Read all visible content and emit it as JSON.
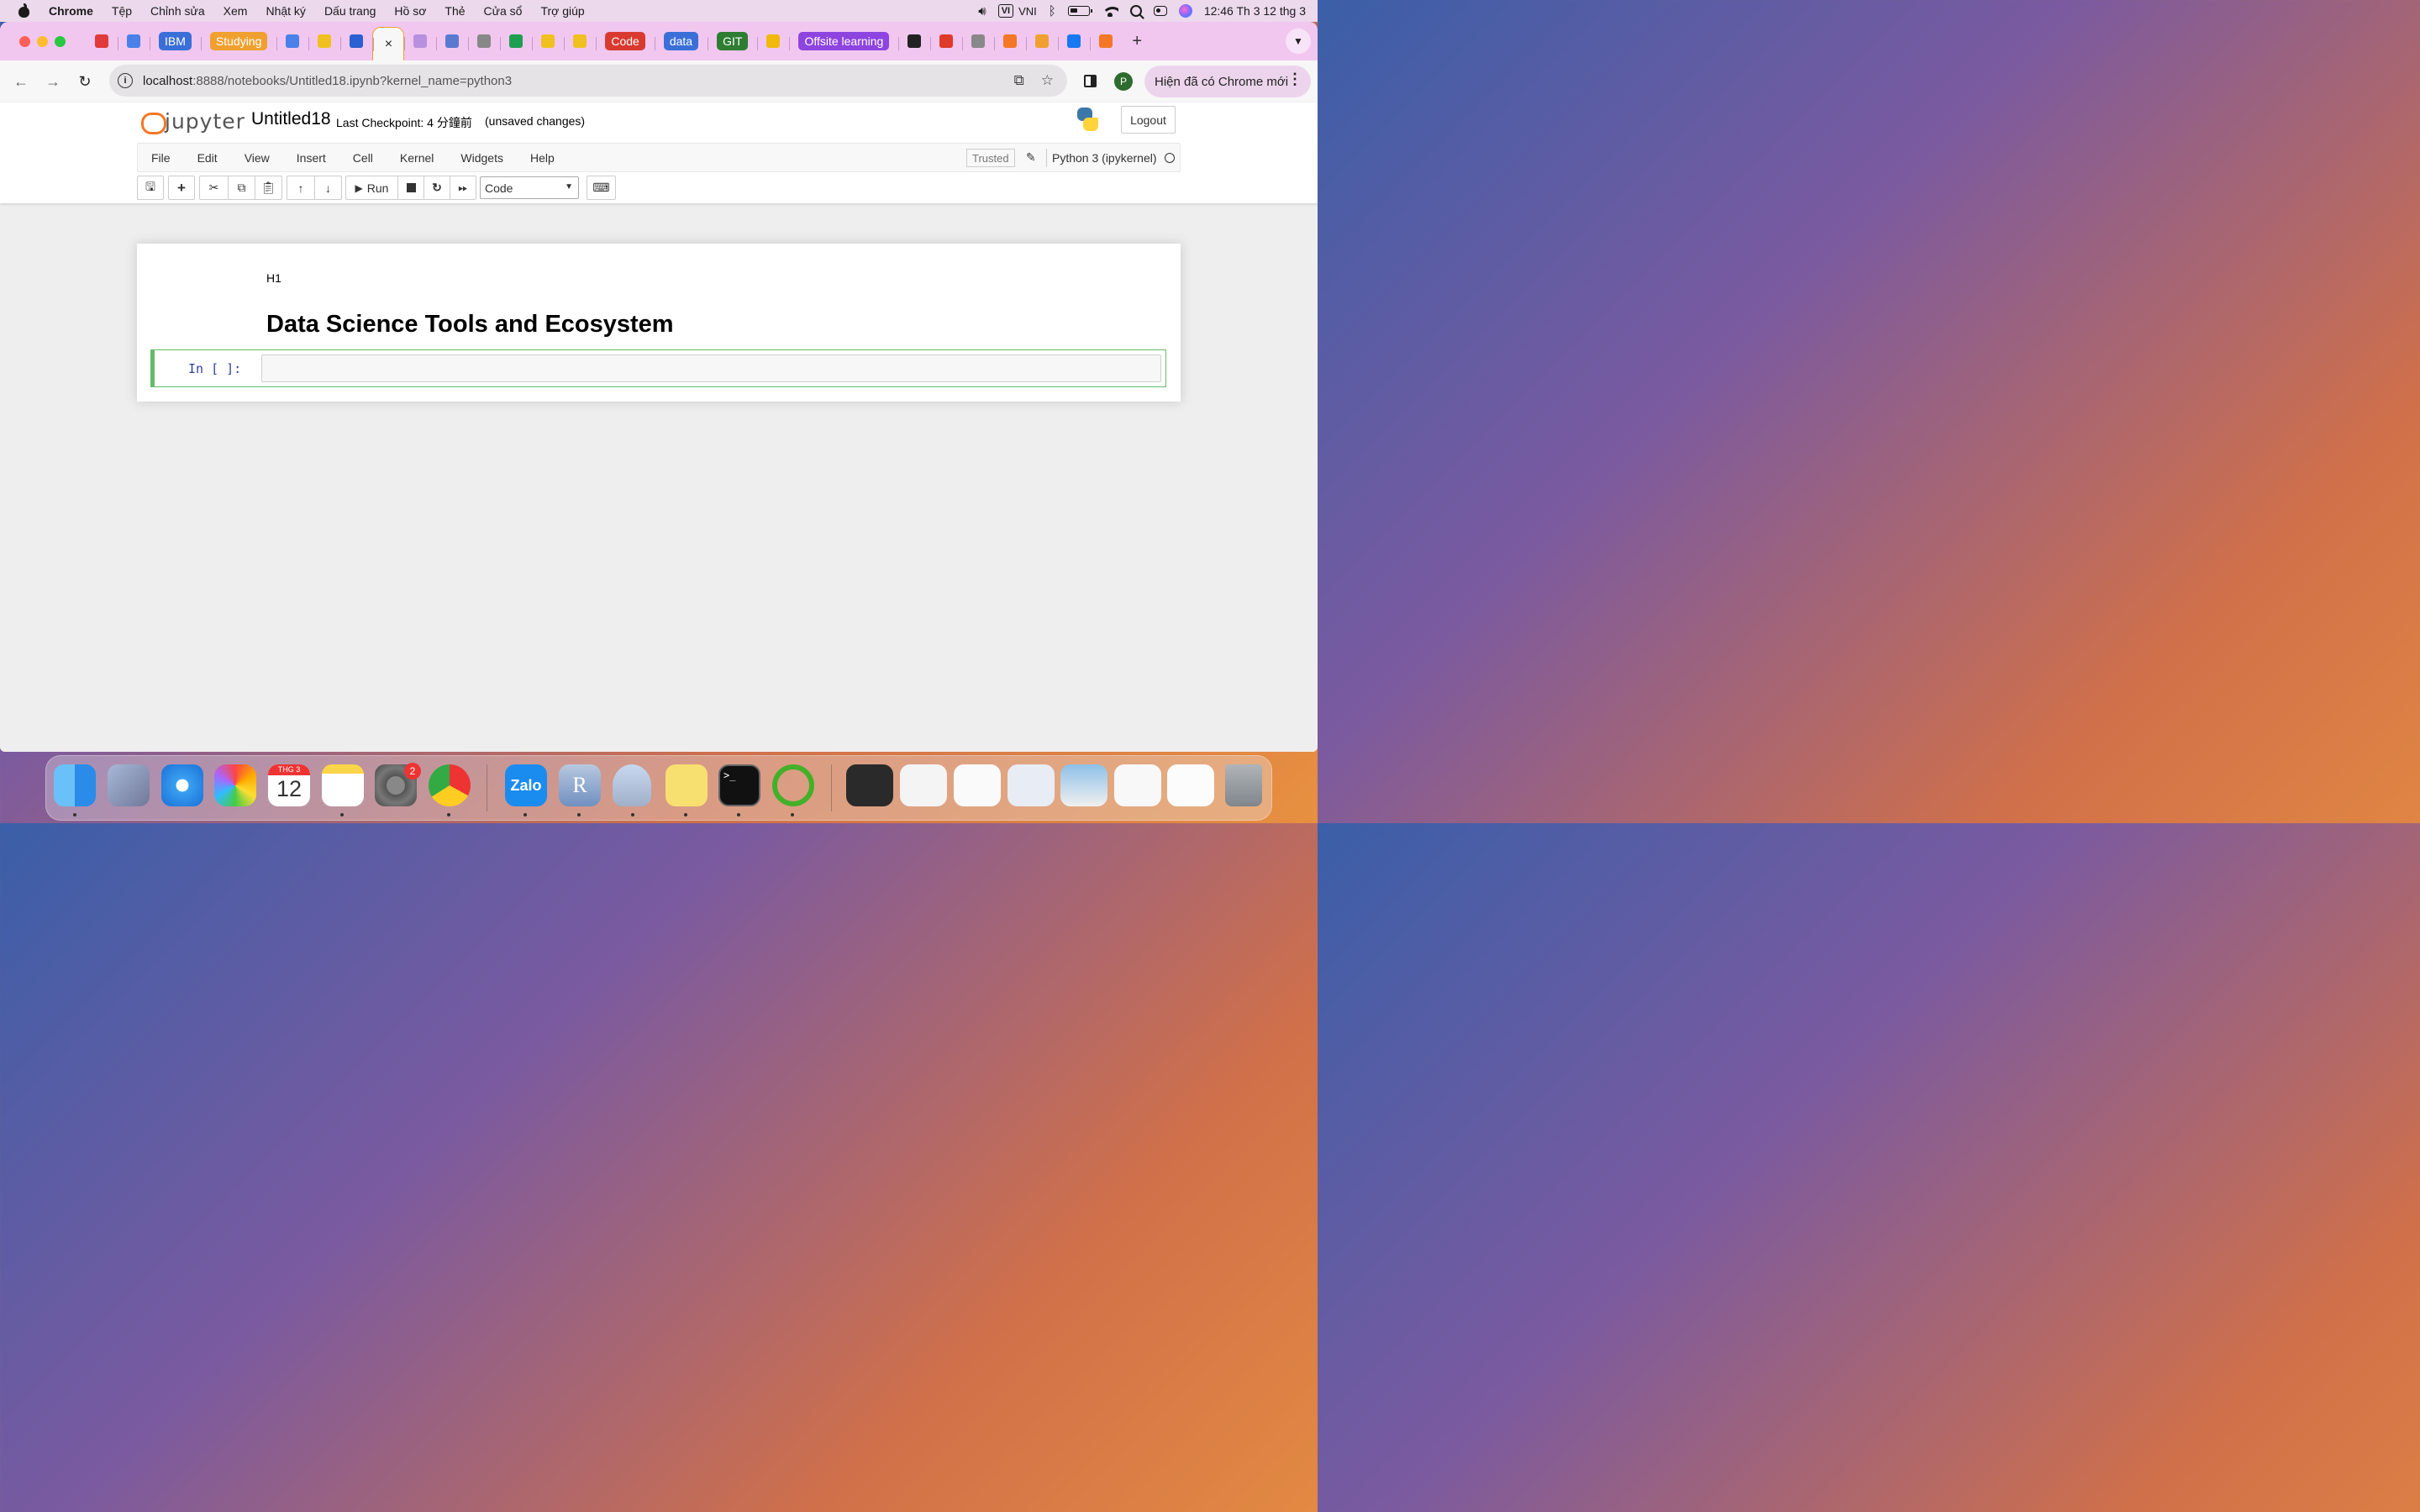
{
  "macos_menubar": {
    "app_name": "Chrome",
    "menus": [
      "Tệp",
      "Chỉnh sửa",
      "Xem",
      "Nhật ký",
      "Dấu trang",
      "Hồ sơ",
      "Thẻ",
      "Cửa sổ",
      "Trợ giúp"
    ],
    "input_method": "VI",
    "input_label": "VNI",
    "clock": "12:46 Th 3 12 thg 3"
  },
  "browser": {
    "tabs": [
      {
        "kind": "favicon",
        "icon": "red-square-icon",
        "color": "#e03a3a"
      },
      {
        "kind": "favicon",
        "icon": "google-docs-icon",
        "color": "#4a80e8"
      },
      {
        "kind": "pill",
        "label": "IBM",
        "color": "#3a6fd8"
      },
      {
        "kind": "pill",
        "label": "Studying",
        "color": "#f0a030"
      },
      {
        "kind": "favicon",
        "icon": "google-docs-icon",
        "color": "#4a80e8"
      },
      {
        "kind": "favicon",
        "icon": "lightbulb-icon",
        "color": "#f0c020"
      },
      {
        "kind": "favicon",
        "icon": "c-logo-icon",
        "color": "#2a60d0"
      },
      {
        "kind": "active",
        "label": "×"
      },
      {
        "kind": "favicon",
        "icon": "aperture-icon",
        "color": "#b890e0"
      },
      {
        "kind": "favicon",
        "icon": "translate-icon",
        "color": "#5a7ad0"
      },
      {
        "kind": "favicon",
        "icon": "globe-icon",
        "color": "#888888"
      },
      {
        "kind": "favicon",
        "icon": "google-sheets-icon",
        "color": "#1e9e50"
      },
      {
        "kind": "favicon",
        "icon": "lightbulb-icon",
        "color": "#f0c020"
      },
      {
        "kind": "favicon",
        "icon": "lightbulb-icon",
        "color": "#f0c020"
      },
      {
        "kind": "pill",
        "label": "Code",
        "color": "#d93a30"
      },
      {
        "kind": "pill",
        "label": "data",
        "color": "#3a6fd8"
      },
      {
        "kind": "pill",
        "label": "GIT",
        "color": "#2e7d32"
      },
      {
        "kind": "favicon",
        "icon": "binance-icon",
        "color": "#f0b90b"
      },
      {
        "kind": "pill",
        "label": "Offsite learning",
        "color": "#8e44e0"
      },
      {
        "kind": "favicon",
        "icon": "jpm-icon",
        "color": "#222222"
      },
      {
        "kind": "favicon",
        "icon": "t-logo-icon",
        "color": "#e03a2a"
      },
      {
        "kind": "favicon",
        "icon": "github-icon",
        "color": "#888888"
      },
      {
        "kind": "favicon",
        "icon": "jupyter-icon",
        "color": "#f37726"
      },
      {
        "kind": "favicon",
        "icon": "bars-icon",
        "color": "#f0a030"
      },
      {
        "kind": "favicon",
        "icon": "facebook-icon",
        "color": "#1877f2"
      },
      {
        "kind": "favicon",
        "icon": "jupyter-icon",
        "color": "#f37726"
      }
    ],
    "new_tab": "+",
    "url_host": "localhost",
    "url_path": ":8888/notebooks/Untitled18.ipynb?kernel_name=python3",
    "profile_initial": "P",
    "new_chrome_label": "Hiện đã có Chrome mới"
  },
  "jupyter": {
    "logo_text": "jupyter",
    "notebook_title": "Untitled18",
    "checkpoint": "Last Checkpoint: 4 分鐘前",
    "unsaved": "(unsaved changes)",
    "logout": "Logout",
    "menu": [
      "File",
      "Edit",
      "View",
      "Insert",
      "Cell",
      "Kernel",
      "Widgets",
      "Help"
    ],
    "trusted": "Trusted",
    "kernel": "Python 3 (ipykernel)",
    "run_label": "Run",
    "cell_type": "Code",
    "cells": {
      "markdown_line1": "H1",
      "markdown_heading": "Data Science Tools and Ecosystem",
      "code_prompt": "In [ ]:"
    }
  },
  "dock": {
    "calendar_month": "THG 3",
    "calendar_day": "12",
    "settings_badge": "2",
    "zalo_label": "Zalo",
    "r_label": "R"
  }
}
